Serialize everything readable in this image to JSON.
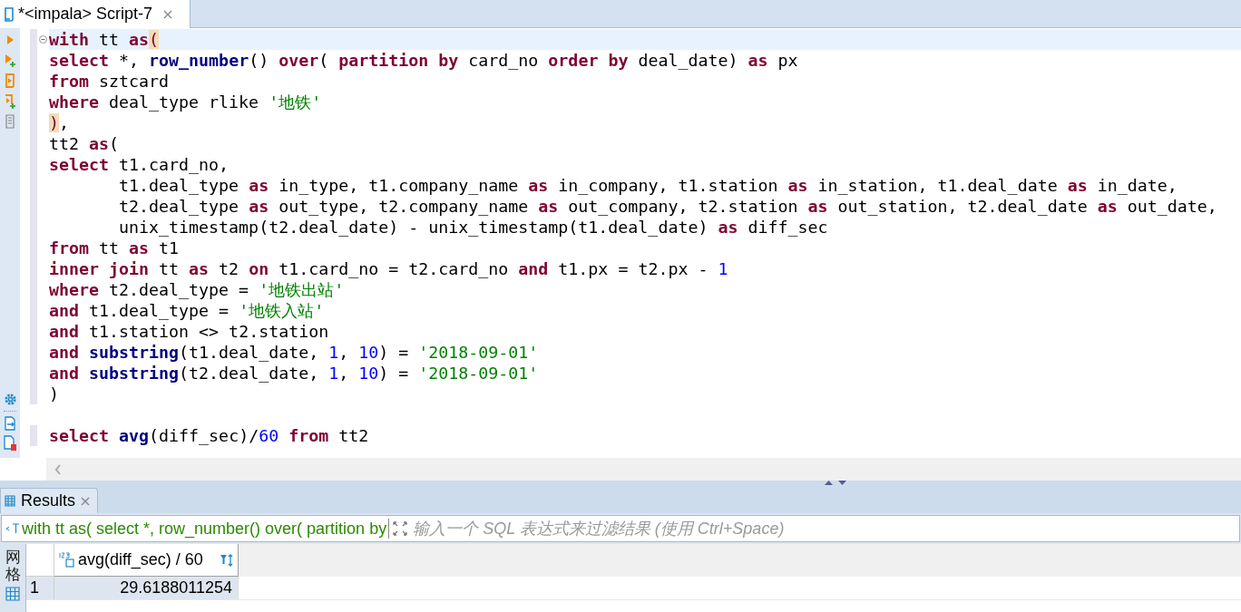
{
  "editor_tab": {
    "title": "*<impala> Script-7"
  },
  "code": {
    "lines": [
      {
        "current": true,
        "tokens": [
          {
            "kind": "keyword",
            "text": "with"
          },
          {
            "kind": "plain",
            "text": " tt "
          },
          {
            "kind": "keyword",
            "text": "as"
          },
          {
            "kind": "bracket",
            "text": "("
          }
        ]
      },
      {
        "current": false,
        "tokens": [
          {
            "kind": "keyword",
            "text": "select"
          },
          {
            "kind": "plain",
            "text": " *, "
          },
          {
            "kind": "function",
            "text": "row_number"
          },
          {
            "kind": "plain",
            "text": "() "
          },
          {
            "kind": "keyword",
            "text": "over"
          },
          {
            "kind": "plain",
            "text": "( "
          },
          {
            "kind": "keyword",
            "text": "partition by"
          },
          {
            "kind": "plain",
            "text": " card_no "
          },
          {
            "kind": "keyword",
            "text": "order by"
          },
          {
            "kind": "plain",
            "text": " deal_date) "
          },
          {
            "kind": "keyword",
            "text": "as"
          },
          {
            "kind": "plain",
            "text": " px"
          }
        ]
      },
      {
        "current": false,
        "tokens": [
          {
            "kind": "keyword",
            "text": "from"
          },
          {
            "kind": "plain",
            "text": " sztcard"
          }
        ]
      },
      {
        "current": false,
        "tokens": [
          {
            "kind": "keyword",
            "text": "where"
          },
          {
            "kind": "plain",
            "text": " deal_type rlike "
          },
          {
            "kind": "string",
            "text": "'地铁'"
          }
        ]
      },
      {
        "current": false,
        "tokens": [
          {
            "kind": "bracket",
            "text": ")"
          },
          {
            "kind": "plain",
            "text": ","
          }
        ]
      },
      {
        "current": false,
        "tokens": [
          {
            "kind": "plain",
            "text": "tt2 "
          },
          {
            "kind": "keyword",
            "text": "as"
          },
          {
            "kind": "plain",
            "text": "("
          }
        ]
      },
      {
        "current": false,
        "tokens": [
          {
            "kind": "keyword",
            "text": "select"
          },
          {
            "kind": "plain",
            "text": " t1.card_no,"
          }
        ]
      },
      {
        "current": false,
        "tokens": [
          {
            "kind": "plain",
            "text": "       t1.deal_type "
          },
          {
            "kind": "keyword",
            "text": "as"
          },
          {
            "kind": "plain",
            "text": " in_type, t1.company_name "
          },
          {
            "kind": "keyword",
            "text": "as"
          },
          {
            "kind": "plain",
            "text": " in_company, t1.station "
          },
          {
            "kind": "keyword",
            "text": "as"
          },
          {
            "kind": "plain",
            "text": " in_station, t1.deal_date "
          },
          {
            "kind": "keyword",
            "text": "as"
          },
          {
            "kind": "plain",
            "text": " in_date,"
          }
        ]
      },
      {
        "current": false,
        "tokens": [
          {
            "kind": "plain",
            "text": "       t2.deal_type "
          },
          {
            "kind": "keyword",
            "text": "as"
          },
          {
            "kind": "plain",
            "text": " out_type, t2.company_name "
          },
          {
            "kind": "keyword",
            "text": "as"
          },
          {
            "kind": "plain",
            "text": " out_company, t2.station "
          },
          {
            "kind": "keyword",
            "text": "as"
          },
          {
            "kind": "plain",
            "text": " out_station, t2.deal_date "
          },
          {
            "kind": "keyword",
            "text": "as"
          },
          {
            "kind": "plain",
            "text": " out_date,"
          }
        ]
      },
      {
        "current": false,
        "tokens": [
          {
            "kind": "plain",
            "text": "       unix_timestamp(t2.deal_date) - unix_timestamp(t1.deal_date) "
          },
          {
            "kind": "keyword",
            "text": "as"
          },
          {
            "kind": "plain",
            "text": " diff_sec"
          }
        ]
      },
      {
        "current": false,
        "tokens": [
          {
            "kind": "keyword",
            "text": "from"
          },
          {
            "kind": "plain",
            "text": " tt "
          },
          {
            "kind": "keyword",
            "text": "as"
          },
          {
            "kind": "plain",
            "text": " t1"
          }
        ]
      },
      {
        "current": false,
        "tokens": [
          {
            "kind": "keyword",
            "text": "inner join"
          },
          {
            "kind": "plain",
            "text": " tt "
          },
          {
            "kind": "keyword",
            "text": "as"
          },
          {
            "kind": "plain",
            "text": " t2 "
          },
          {
            "kind": "keyword",
            "text": "on"
          },
          {
            "kind": "plain",
            "text": " t1.card_no = t2.card_no "
          },
          {
            "kind": "keyword",
            "text": "and"
          },
          {
            "kind": "plain",
            "text": " t1.px = t2.px - "
          },
          {
            "kind": "number",
            "text": "1"
          }
        ]
      },
      {
        "current": false,
        "tokens": [
          {
            "kind": "keyword",
            "text": "where"
          },
          {
            "kind": "plain",
            "text": " t2.deal_type = "
          },
          {
            "kind": "string",
            "text": "'地铁出站'"
          }
        ]
      },
      {
        "current": false,
        "tokens": [
          {
            "kind": "keyword",
            "text": "and"
          },
          {
            "kind": "plain",
            "text": " t1.deal_type = "
          },
          {
            "kind": "string",
            "text": "'地铁入站'"
          }
        ]
      },
      {
        "current": false,
        "tokens": [
          {
            "kind": "keyword",
            "text": "and"
          },
          {
            "kind": "plain",
            "text": " t1.station <> t2.station"
          }
        ]
      },
      {
        "current": false,
        "tokens": [
          {
            "kind": "keyword",
            "text": "and "
          },
          {
            "kind": "function",
            "text": "substring"
          },
          {
            "kind": "plain",
            "text": "(t1.deal_date, "
          },
          {
            "kind": "number",
            "text": "1"
          },
          {
            "kind": "plain",
            "text": ", "
          },
          {
            "kind": "number",
            "text": "10"
          },
          {
            "kind": "plain",
            "text": ") = "
          },
          {
            "kind": "string",
            "text": "'2018-09-01'"
          }
        ]
      },
      {
        "current": false,
        "tokens": [
          {
            "kind": "keyword",
            "text": "and "
          },
          {
            "kind": "function",
            "text": "substring"
          },
          {
            "kind": "plain",
            "text": "(t2.deal_date, "
          },
          {
            "kind": "number",
            "text": "1"
          },
          {
            "kind": "plain",
            "text": ", "
          },
          {
            "kind": "number",
            "text": "10"
          },
          {
            "kind": "plain",
            "text": ") = "
          },
          {
            "kind": "string",
            "text": "'2018-09-01'"
          }
        ]
      },
      {
        "current": false,
        "tokens": [
          {
            "kind": "plain",
            "text": ")"
          }
        ]
      },
      {
        "current": false
      },
      {
        "current": false,
        "tokens": [
          {
            "kind": "keyword",
            "text": "select "
          },
          {
            "kind": "function",
            "text": "avg"
          },
          {
            "kind": "plain",
            "text": "(diff_sec)/"
          },
          {
            "kind": "number",
            "text": "60"
          },
          {
            "kind": "keyword",
            "text": " from"
          },
          {
            "kind": "plain",
            "text": " tt2"
          }
        ]
      }
    ]
  },
  "results_tab": {
    "title": "Results"
  },
  "filter": {
    "query": "with tt as( select *, row_number() over( partition by",
    "placeholder": "输入一个 SQL 表达式来过滤结果 (使用 Ctrl+Space)"
  },
  "side_tab": {
    "label": "网格"
  },
  "grid": {
    "columns": [
      "avg(diff_sec) / 60"
    ],
    "rows": [
      {
        "number": "1",
        "selected": true,
        "cells": [
          "29.6188011254"
        ]
      }
    ]
  }
}
